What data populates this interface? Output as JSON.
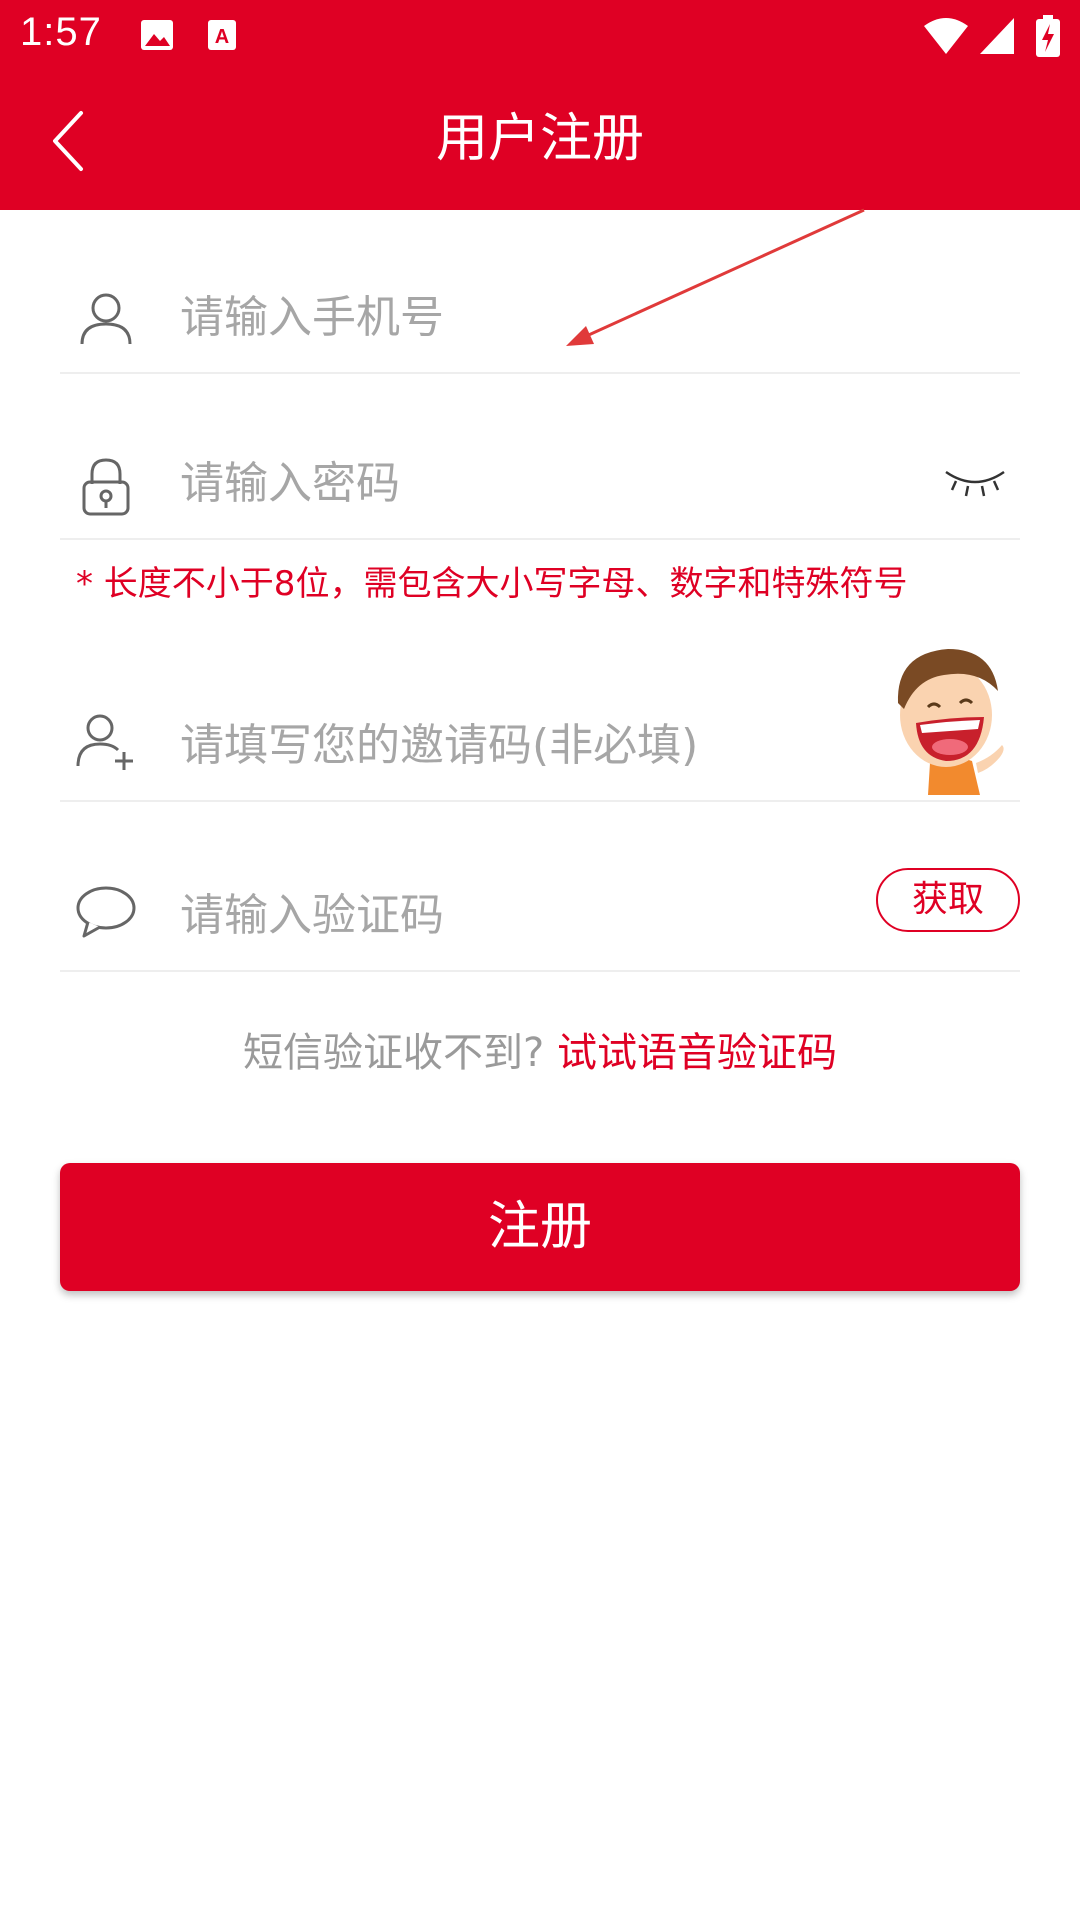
{
  "status_bar": {
    "time": "1:57",
    "icons": [
      "image-icon",
      "font-a-icon",
      "wifi-icon",
      "signal-icon",
      "battery-charging-icon"
    ]
  },
  "header": {
    "title": "用户注册",
    "back_icon": "chevron-left-icon",
    "background": "#DF0024"
  },
  "form": {
    "phone": {
      "placeholder": "请输入手机号",
      "value": "",
      "icon": "user-icon"
    },
    "password": {
      "placeholder": "请输入密码",
      "value": "",
      "icon": "lock-icon",
      "toggle_icon": "eye-closed-icon"
    },
    "password_hint": "* 长度不小于8位，需包含大小写字母、数字和特殊符号",
    "invite": {
      "placeholder": "请填写您的邀请码(非必填)",
      "value": "",
      "icon": "add-user-icon"
    },
    "code": {
      "placeholder": "请输入验证码",
      "value": "",
      "icon": "chat-bubble-icon",
      "get_label": "获取"
    }
  },
  "voice": {
    "prefix": "短信验证收不到?",
    "link": "试试语音验证码"
  },
  "register_button": "注册",
  "colors": {
    "accent": "#DF0024",
    "placeholder": "#A6A6A6",
    "divider": "#EEEEEE"
  }
}
